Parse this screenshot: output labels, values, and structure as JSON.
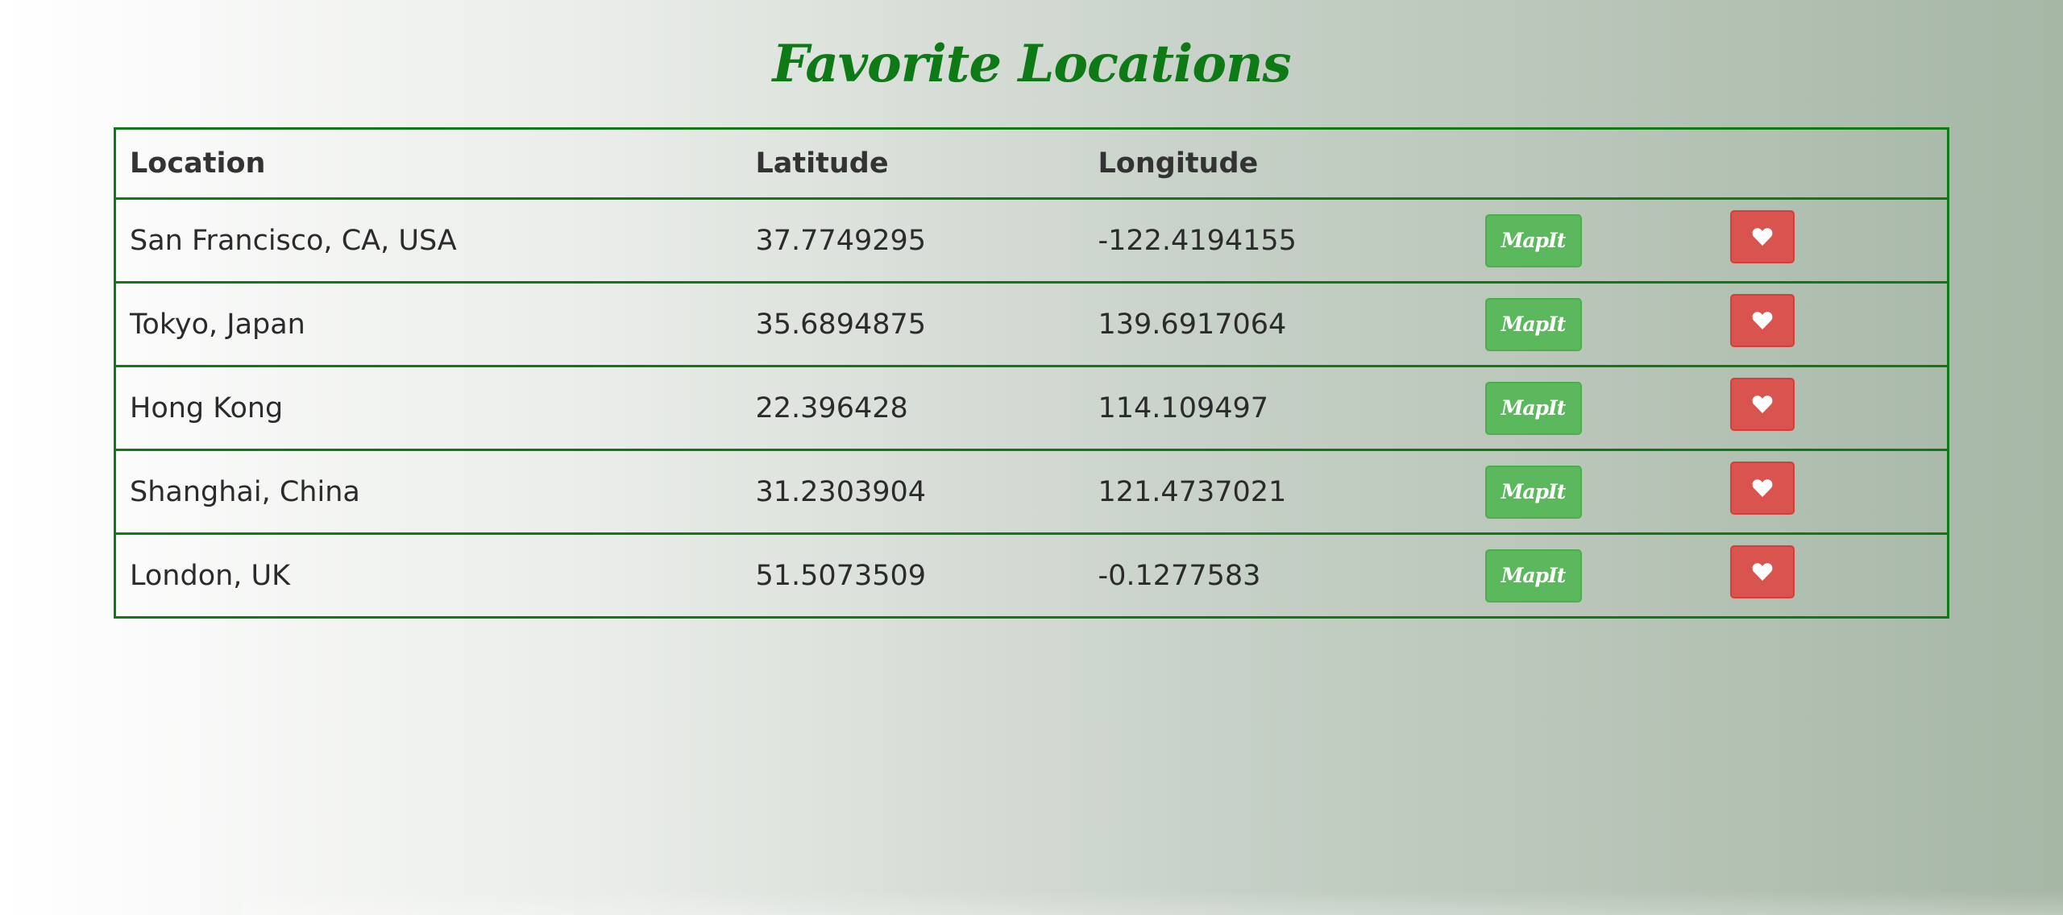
{
  "page": {
    "title": "Favorite Locations"
  },
  "table": {
    "headers": [
      "Location",
      "Latitude",
      "Longitude",
      "",
      ""
    ],
    "rows": [
      {
        "location": "San Francisco, CA, USA",
        "latitude": "37.7749295",
        "longitude": "-122.4194155",
        "map_label": "MapIt",
        "fav_icon": "heart-icon"
      },
      {
        "location": "Tokyo, Japan",
        "latitude": "35.6894875",
        "longitude": "139.6917064",
        "map_label": "MapIt",
        "fav_icon": "heart-icon"
      },
      {
        "location": "Hong Kong",
        "latitude": "22.396428",
        "longitude": "114.109497",
        "map_label": "MapIt",
        "fav_icon": "heart-icon"
      },
      {
        "location": "Shanghai, China",
        "latitude": "31.2303904",
        "longitude": "121.4737021",
        "map_label": "MapIt",
        "fav_icon": "heart-icon"
      },
      {
        "location": "London, UK",
        "latitude": "51.5073509",
        "longitude": "-0.1277583",
        "map_label": "MapIt",
        "fav_icon": "heart-icon"
      }
    ]
  },
  "colors": {
    "title": "#0d7a16",
    "table_border": "#0e7a16",
    "mapit_button": "#5cb85c",
    "fav_button": "#d9534f"
  }
}
